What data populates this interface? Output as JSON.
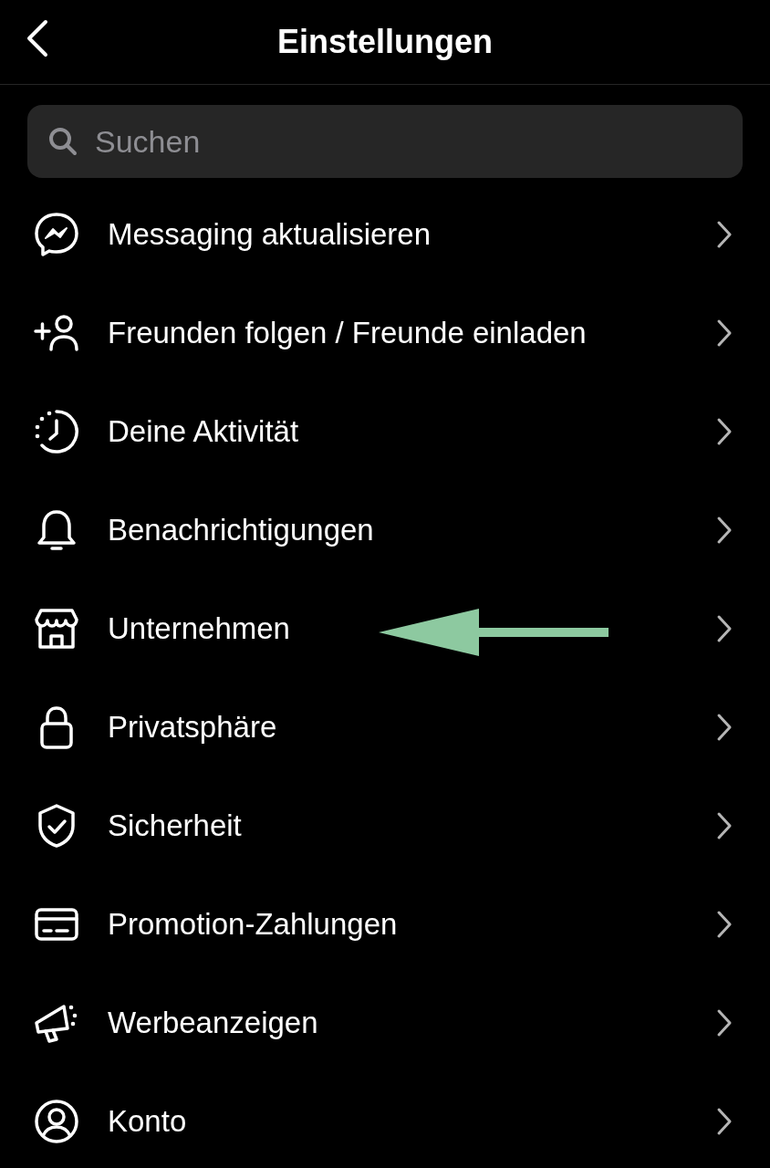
{
  "header": {
    "title": "Einstellungen"
  },
  "search": {
    "placeholder": "Suchen"
  },
  "items": [
    {
      "label": "Messaging aktualisieren",
      "arrow": false
    },
    {
      "label": "Freunden folgen / Freunde einladen",
      "arrow": false
    },
    {
      "label": "Deine Aktivität",
      "arrow": false
    },
    {
      "label": "Benachrichtigungen",
      "arrow": false
    },
    {
      "label": "Unternehmen",
      "arrow": true
    },
    {
      "label": "Privatsphäre",
      "arrow": false
    },
    {
      "label": "Sicherheit",
      "arrow": false
    },
    {
      "label": "Promotion-Zahlungen",
      "arrow": false
    },
    {
      "label": "Werbeanzeigen",
      "arrow": false
    },
    {
      "label": "Konto",
      "arrow": false
    }
  ]
}
